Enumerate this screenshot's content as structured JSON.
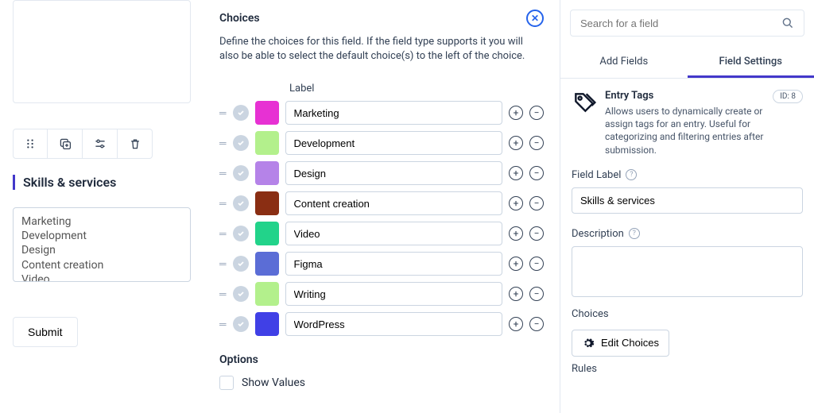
{
  "left": {
    "field_title": "Skills & services",
    "preview_items": [
      "Marketing",
      "Development",
      "Design",
      "Content creation",
      "Video"
    ],
    "submit_label": "Submit"
  },
  "mid": {
    "title": "Choices",
    "description": "Define the choices for this field. If the field type supports it you will also be able to select the default choice(s) to the left of the choice.",
    "label_header": "Label",
    "choices": [
      {
        "label": "Marketing",
        "color": "#e731d3"
      },
      {
        "label": "Development",
        "color": "#b3f08c"
      },
      {
        "label": "Design",
        "color": "#b583e8"
      },
      {
        "label": "Content creation",
        "color": "#8a2e13"
      },
      {
        "label": "Video",
        "color": "#22d38a"
      },
      {
        "label": "Figma",
        "color": "#5b6dd6"
      },
      {
        "label": "Writing",
        "color": "#b3f08c"
      },
      {
        "label": "WordPress",
        "color": "#4040e6"
      }
    ],
    "options_title": "Options",
    "show_values_label": "Show Values"
  },
  "right": {
    "search_placeholder": "Search for a field",
    "tabs": {
      "add": "Add Fields",
      "settings": "Field Settings"
    },
    "meta": {
      "title": "Entry Tags",
      "desc": "Allows users to dynamically create or assign tags for an entry. Useful for categorizing and filtering entries after submission.",
      "id_badge": "ID: 8"
    },
    "sections": {
      "field_label": "Field Label",
      "field_label_value": "Skills & services",
      "description_label": "Description",
      "choices_label": "Choices",
      "edit_choices": "Edit Choices",
      "rules_label": "Rules"
    }
  }
}
